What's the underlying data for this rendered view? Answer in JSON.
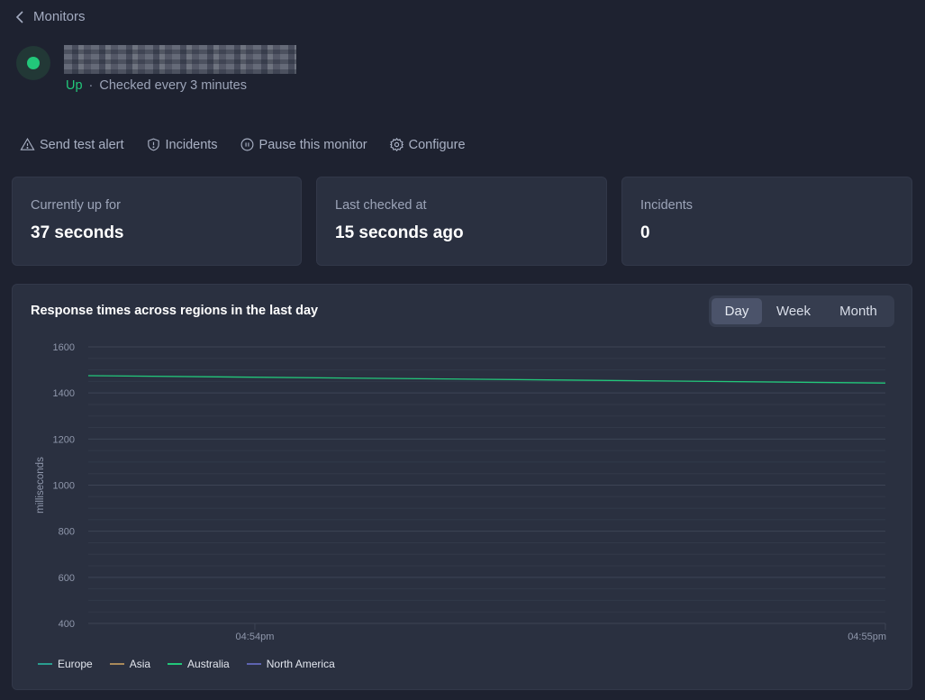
{
  "nav": {
    "back_label": "Monitors"
  },
  "monitor": {
    "name_redacted": true,
    "status": "Up",
    "separator": "·",
    "check_frequency": "Checked every 3 minutes",
    "status_color": "#22c77a"
  },
  "actions": [
    {
      "label": "Send test alert",
      "icon": "warning-triangle-icon"
    },
    {
      "label": "Incidents",
      "icon": "shield-alert-icon"
    },
    {
      "label": "Pause this monitor",
      "icon": "pause-circle-icon"
    },
    {
      "label": "Configure",
      "icon": "gear-icon"
    }
  ],
  "stats": [
    {
      "label": "Currently up for",
      "value": "37 seconds"
    },
    {
      "label": "Last checked at",
      "value": "15 seconds ago"
    },
    {
      "label": "Incidents",
      "value": "0"
    }
  ],
  "range_selector": {
    "options": [
      "Day",
      "Week",
      "Month"
    ],
    "selected": "Day"
  },
  "chart_data": {
    "type": "line",
    "title": "Response times across regions in the last day",
    "xlabel": "",
    "ylabel": "milliseconds",
    "ylim": [
      400,
      1600
    ],
    "yticks": [
      400,
      600,
      800,
      1000,
      1200,
      1400,
      1600
    ],
    "y_minor_step": 50,
    "grid": true,
    "x_range": [
      "04:53:41pm",
      "04:55pm"
    ],
    "xticks": [
      {
        "label": "04:54pm",
        "position_fraction": 0.209
      },
      {
        "label": "04:55pm",
        "position_fraction": 1.0
      }
    ],
    "legend_position": "bottom-left",
    "series": [
      {
        "name": "Europe",
        "color": "#2a9d8f",
        "points": []
      },
      {
        "name": "Asia",
        "color": "#a8895a",
        "points": []
      },
      {
        "name": "Australia",
        "color": "#22c77a",
        "points": [
          {
            "t": 0.0,
            "value": 1475
          },
          {
            "t": 1.0,
            "value": 1443
          }
        ]
      },
      {
        "name": "North America",
        "color": "#5d63b0",
        "points": []
      }
    ]
  }
}
